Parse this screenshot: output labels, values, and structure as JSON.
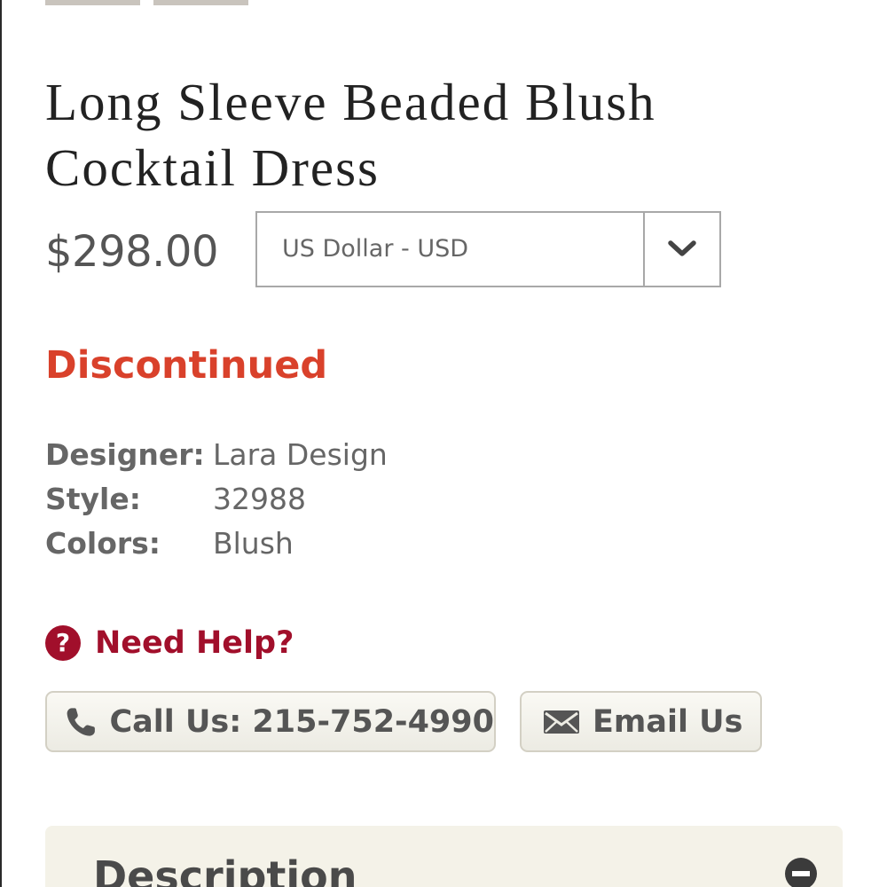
{
  "product": {
    "title": "Long Sleeve Beaded Blush Cocktail Dress",
    "price": "$298.00",
    "status": "Discontinued"
  },
  "currency": {
    "selected": "US Dollar - USD",
    "arrow_icon": "chevron-down-icon"
  },
  "specs": [
    {
      "label": "Designer:",
      "value": "Lara Design"
    },
    {
      "label": "Style:",
      "value": "32988"
    },
    {
      "label": "Colors:",
      "value": "Blush"
    }
  ],
  "help": {
    "icon_glyph": "?",
    "label": "Need Help?",
    "call_label": "Call Us: 215-752-4990",
    "email_label": "Email Us"
  },
  "description": {
    "title": "Description",
    "toggle_icon": "minus-circle-icon"
  },
  "colors": {
    "status": "#d9412b",
    "help_accent": "#a10f2b",
    "panel_bg": "#f4f2e8"
  }
}
